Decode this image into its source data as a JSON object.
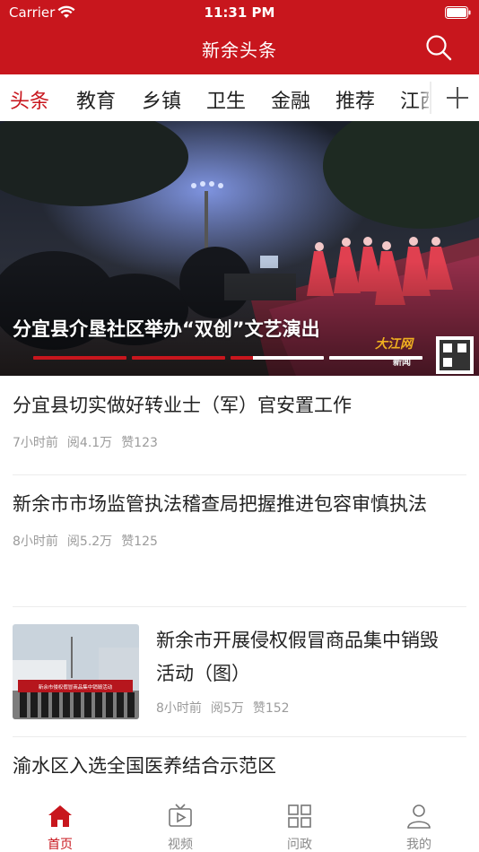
{
  "status_bar": {
    "carrier": "Carrier",
    "time": "11:31 PM"
  },
  "header": {
    "title": "新余头条",
    "search_icon": "search-icon"
  },
  "tabs": [
    {
      "label": "头条",
      "active": true
    },
    {
      "label": "教育",
      "active": false
    },
    {
      "label": "乡镇",
      "active": false
    },
    {
      "label": "卫生",
      "active": false
    },
    {
      "label": "金融",
      "active": false
    },
    {
      "label": "推荐",
      "active": false
    },
    {
      "label": "江西",
      "active": false
    }
  ],
  "banner": {
    "caption": "分宜县介垦社区举办“双创”文艺演出",
    "watermark": "大江网",
    "watermark_sub": "新闻",
    "slide_count": 4,
    "current_slide": 3
  },
  "news": [
    {
      "title": "分宜县切实做好转业士（军）官安置工作",
      "time": "7小时前",
      "reads": "阅4.1万",
      "likes": "赞123",
      "has_thumb": false
    },
    {
      "title": "新余市市场监管执法稽查局把握推进包容审慎执法",
      "time": "8小时前",
      "reads": "阅5.2万",
      "likes": "赞125",
      "has_thumb": false
    },
    {
      "title": "新余市开展侵权假冒商品集中销毁活动（图）",
      "time": "8小时前",
      "reads": "阅5万",
      "likes": "赞152",
      "has_thumb": true,
      "thumb_banner_text": "新余市侵权假冒商品集中销毁活动"
    },
    {
      "title": "渝水区入选全国医养结合示范区",
      "has_thumb": false
    }
  ],
  "tab_bar": [
    {
      "label": "首页",
      "icon": "home-icon",
      "active": true
    },
    {
      "label": "视频",
      "icon": "tv-icon",
      "active": false
    },
    {
      "label": "问政",
      "icon": "grid-icon",
      "active": false
    },
    {
      "label": "我的",
      "icon": "person-icon",
      "active": false
    }
  ],
  "colors": {
    "brand": "#c8161d",
    "muted": "#9b9b9b"
  }
}
